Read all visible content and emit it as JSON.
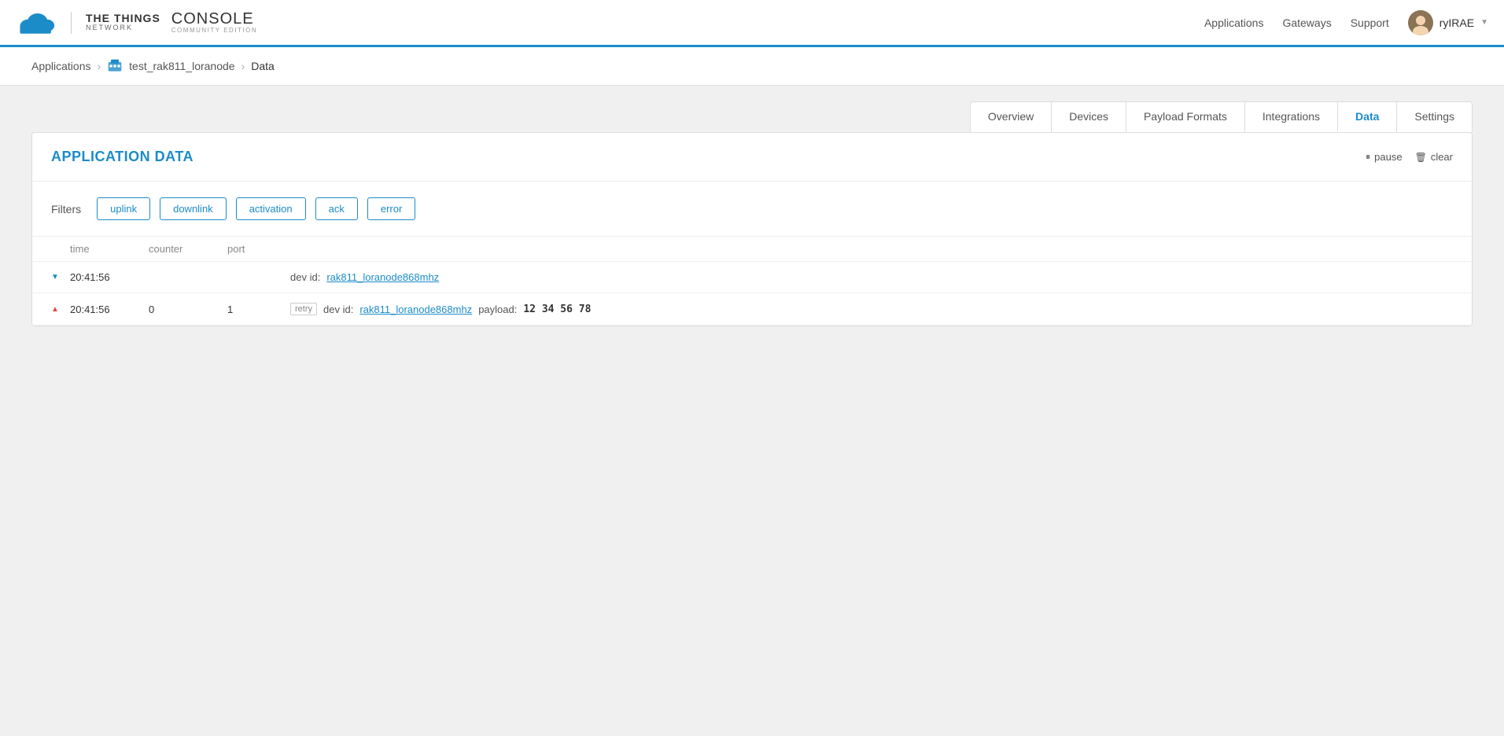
{
  "navbar": {
    "brand_ttn": "THE THINGS",
    "brand_network": "NETWORK",
    "console_main": "CONSOLE",
    "console_sub": "COMMUNITY EDITION",
    "nav_links": [
      "Applications",
      "Gateways",
      "Support"
    ],
    "username": "ryIRAE"
  },
  "breadcrumb": {
    "root": "Applications",
    "app_name": "test_rak811_loranode",
    "current": "Data"
  },
  "tabs": [
    {
      "label": "Overview",
      "active": false
    },
    {
      "label": "Devices",
      "active": false
    },
    {
      "label": "Payload Formats",
      "active": false
    },
    {
      "label": "Integrations",
      "active": false
    },
    {
      "label": "Data",
      "active": true
    },
    {
      "label": "Settings",
      "active": false
    }
  ],
  "app_data": {
    "title": "APPLICATION DATA",
    "pause_label": "pause",
    "clear_label": "clear"
  },
  "filters": {
    "label": "Filters",
    "buttons": [
      "uplink",
      "downlink",
      "activation",
      "ack",
      "error"
    ]
  },
  "table": {
    "headers": {
      "time": "time",
      "counter": "counter",
      "port": "port"
    },
    "rows": [
      {
        "direction": "down",
        "time": "20:41:56",
        "counter": "",
        "port": "",
        "badge": "",
        "dev_id_label": "dev id:",
        "dev_id": "rak811_loranode868mhz",
        "payload_label": "",
        "payload": ""
      },
      {
        "direction": "up",
        "time": "20:41:56",
        "counter": "0",
        "port": "1",
        "badge": "retry",
        "dev_id_label": "dev id:",
        "dev_id": "rak811_loranode868mhz",
        "payload_label": "payload:",
        "payload": "12 34 56 78"
      }
    ]
  }
}
